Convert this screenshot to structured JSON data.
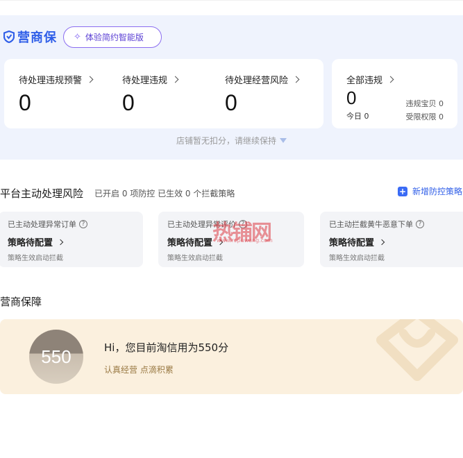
{
  "brand": {
    "name": "营商保"
  },
  "version_pill": {
    "label": "体验简约智能版"
  },
  "metrics": [
    {
      "label": "待处理违规预警",
      "value": "0"
    },
    {
      "label": "待处理违规",
      "value": "0"
    },
    {
      "label": "待处理经营风险",
      "value": "0"
    }
  ],
  "all_violations": {
    "label": "全部违规",
    "value": "0",
    "today": "今日 0",
    "violation_items": "违规宝贝 0",
    "restricted": "受限权限 0"
  },
  "notice": "店铺暂无扣分，请继续保持",
  "risk_section": {
    "title": "平台主动处理风险",
    "subtitle": "已开启 0 项防控 已生效 0 个拦截策略",
    "add_label": "新增防控策略"
  },
  "policies": [
    {
      "title": "已主动处理异常订单",
      "link": "策略待配置",
      "note": "策略生效启动拦截"
    },
    {
      "title": "已主动处理异常评价",
      "link": "策略待配置",
      "note": "策略生效启动拦截"
    },
    {
      "title": "已主动拦截黄牛恶意下单",
      "link": "策略待配置",
      "note": "策略生效启动拦截"
    }
  ],
  "watermark": {
    "main": "热铺网",
    "url": "www.repuwang.com"
  },
  "guarantee": {
    "title": "营商保障",
    "score": "550",
    "greeting": "Hi，您目前淘信用为550分",
    "tagline": "认真经营 点滴积累"
  },
  "colors": {
    "accent": "#2f5ee8",
    "band": "#eff3fd",
    "guarantee_bg": "#fbf0de"
  }
}
